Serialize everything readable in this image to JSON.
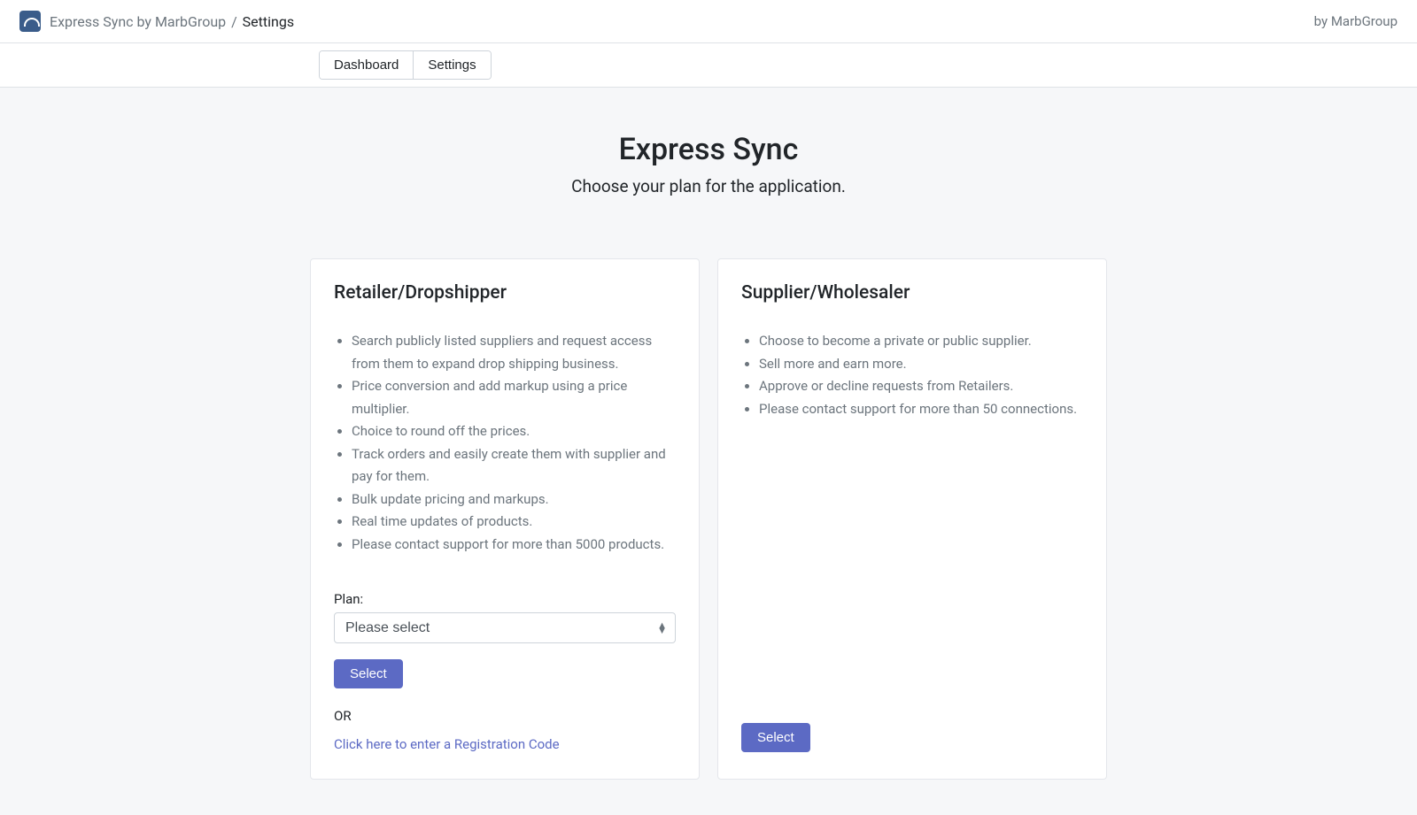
{
  "header": {
    "breadcrumb_app": "Express Sync by MarbGroup",
    "breadcrumb_current": "Settings",
    "by_text": "by MarbGroup"
  },
  "tabs": {
    "dashboard": "Dashboard",
    "settings": "Settings"
  },
  "hero": {
    "title": "Express Sync",
    "subtitle": "Choose your plan for the application."
  },
  "retailer": {
    "title": "Retailer/Dropshipper",
    "features": [
      "Search publicly listed suppliers and request access from them to expand drop shipping business.",
      "Price conversion and add markup using a price multiplier.",
      "Choice to round off the prices.",
      "Track orders and easily create them with supplier and pay for them.",
      "Bulk update pricing and markups.",
      "Real time updates of products.",
      "Please contact support for more than 5000 products."
    ],
    "plan_label": "Plan:",
    "plan_placeholder": "Please select",
    "select_btn": "Select",
    "or_text": "OR",
    "reg_link": "Click here to enter a Registration Code"
  },
  "supplier": {
    "title": "Supplier/Wholesaler",
    "features": [
      "Choose to become a private or public supplier.",
      "Sell more and earn more.",
      "Approve or decline requests from Retailers.",
      "Please contact support for more than 50 connections."
    ],
    "select_btn": "Select"
  }
}
